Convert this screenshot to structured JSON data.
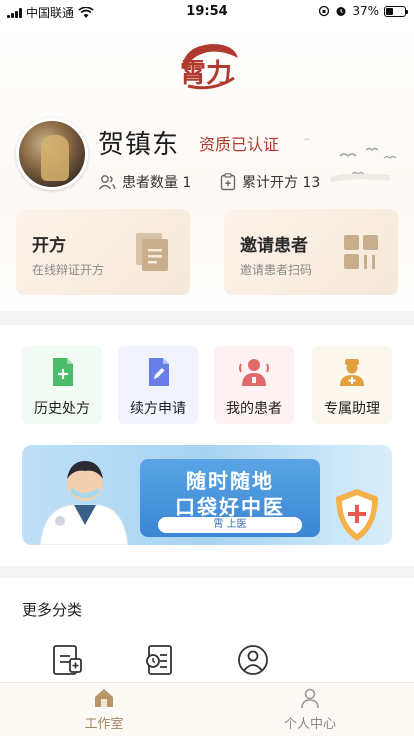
{
  "status_bar": {
    "carrier": "中国联通",
    "time": "19:54",
    "battery_percent": "37%",
    "battery_level": 0.37
  },
  "brand": {
    "logo_text": "霄力",
    "accent_color": "#b03a2e"
  },
  "profile": {
    "name": "贺镇东",
    "certification": "资质已认证",
    "patient_count_label": "患者数量 1",
    "prescription_count_label": "累计开方 13"
  },
  "action_cards": [
    {
      "title": "开方",
      "subtitle": "在线辩证开方",
      "icon": "prescription-doc-icon"
    },
    {
      "title": "邀请患者",
      "subtitle": "邀请患者扫码",
      "icon": "qr-code-icon"
    }
  ],
  "services": [
    {
      "label": "历史处方",
      "icon": "history-doc-icon",
      "color": "#4cbb6a"
    },
    {
      "label": "续方申请",
      "icon": "renew-doc-icon",
      "color": "#5b73e0"
    },
    {
      "label": "我的患者",
      "icon": "patient-icon",
      "color": "#e06a6a"
    },
    {
      "label": "专属助理",
      "icon": "assistant-icon",
      "color": "#e0a040"
    }
  ],
  "banner": {
    "line1": "随时随地",
    "line2": "口袋好中医",
    "pill": "霄 上医"
  },
  "more": {
    "title": "更多分类",
    "icons": [
      "medicine-list-icon",
      "schedule-doc-icon",
      "user-circle-icon"
    ]
  },
  "tabbar": {
    "tabs": [
      {
        "label": "工作室",
        "icon": "home-icon",
        "active": true
      },
      {
        "label": "个人中心",
        "icon": "person-icon",
        "active": false
      }
    ]
  }
}
